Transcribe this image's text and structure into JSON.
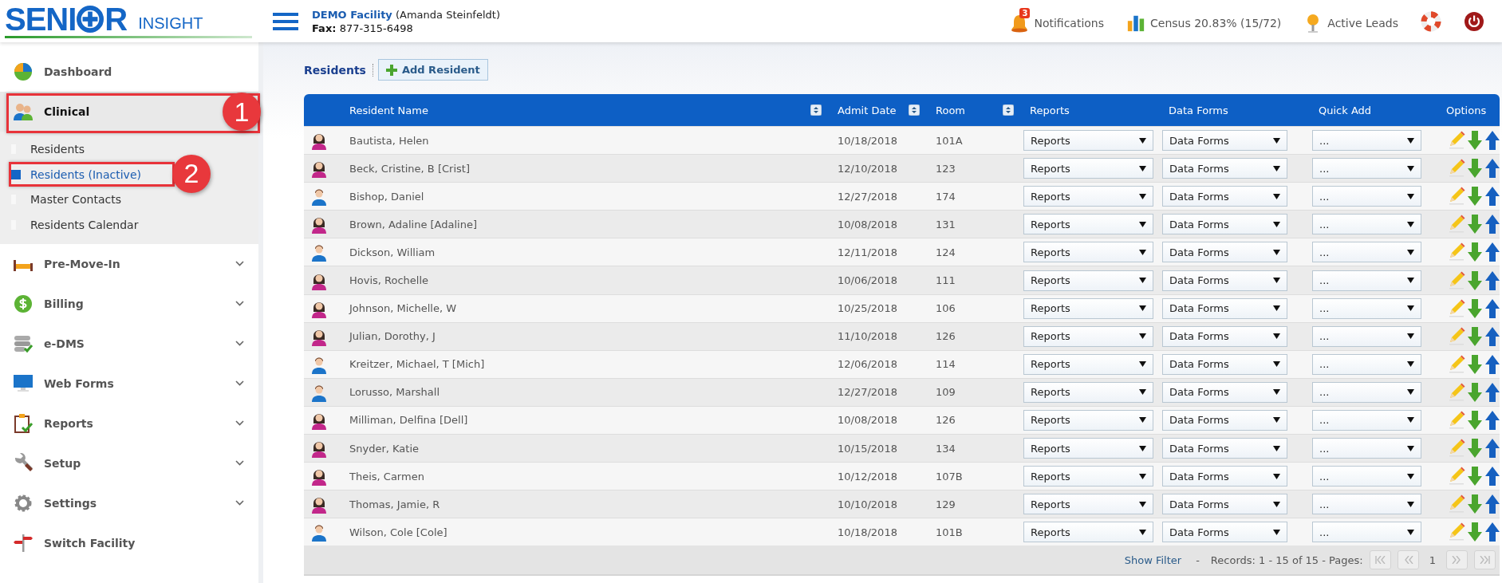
{
  "logo": {
    "left": "SENI",
    "right": "R",
    "tagline": "INSIGHT"
  },
  "facility": {
    "name": "DEMO Facility",
    "user": "(Amanda Steinfeldt)",
    "fax_label": "Fax:",
    "fax": "877-315-6498"
  },
  "top_links": [
    {
      "label": "Notifications",
      "badge": "3"
    },
    {
      "label": "Census 20.83% (15/72)"
    },
    {
      "label": "Active Leads"
    }
  ],
  "sidebar": {
    "items": [
      {
        "label": "Dashboard",
        "kind": "link"
      },
      {
        "label": "Clinical",
        "kind": "group",
        "expanded": true,
        "callout": "1",
        "children": [
          {
            "label": "Residents",
            "selected": false
          },
          {
            "label": "Residents (Inactive)",
            "selected": true,
            "callout": "2"
          },
          {
            "label": "Master Contacts",
            "selected": false
          },
          {
            "label": "Residents Calendar",
            "selected": false
          }
        ]
      },
      {
        "label": "Pre-Move-In",
        "kind": "group",
        "expanded": false
      },
      {
        "label": "Billing",
        "kind": "group",
        "expanded": false
      },
      {
        "label": "e-DMS",
        "kind": "group",
        "expanded": false
      },
      {
        "label": "Web Forms",
        "kind": "group",
        "expanded": false
      },
      {
        "label": "Reports",
        "kind": "group",
        "expanded": false
      },
      {
        "label": "Setup",
        "kind": "group",
        "expanded": false
      },
      {
        "label": "Settings",
        "kind": "group",
        "expanded": false
      },
      {
        "label": "Switch Facility",
        "kind": "link"
      }
    ]
  },
  "page": {
    "title": "Residents",
    "add_button": "Add Resident"
  },
  "table": {
    "columns": [
      {
        "label": "Resident Name"
      },
      {
        "label": "Admit Date"
      },
      {
        "label": "Room"
      },
      {
        "label": "Reports"
      },
      {
        "label": "Data Forms"
      },
      {
        "label": "Quick Add"
      },
      {
        "label": "Options"
      }
    ],
    "rows": [
      {
        "kind": "female",
        "name": "Bautista, Helen",
        "admit": "10/18/2018",
        "room": "101A",
        "reports": "Reports",
        "data_forms": "Data Forms",
        "quick_add": "..."
      },
      {
        "kind": "female",
        "name": "Beck, Cristine, B [Crist]",
        "admit": "12/10/2018",
        "room": "123",
        "reports": "Reports",
        "data_forms": "Data Forms",
        "quick_add": "..."
      },
      {
        "kind": "male",
        "name": "Bishop, Daniel",
        "admit": "12/27/2018",
        "room": "174",
        "reports": "Reports",
        "data_forms": "Data Forms",
        "quick_add": "..."
      },
      {
        "kind": "female",
        "name": "Brown, Adaline [Adaline]",
        "admit": "10/08/2018",
        "room": "131",
        "reports": "Reports",
        "data_forms": "Data Forms",
        "quick_add": "..."
      },
      {
        "kind": "male",
        "name": "Dickson, William",
        "admit": "12/11/2018",
        "room": "124",
        "reports": "Reports",
        "data_forms": "Data Forms",
        "quick_add": "..."
      },
      {
        "kind": "female",
        "name": "Hovis, Rochelle",
        "admit": "10/06/2018",
        "room": "111",
        "reports": "Reports",
        "data_forms": "Data Forms",
        "quick_add": "..."
      },
      {
        "kind": "female",
        "name": "Johnson, Michelle, W",
        "admit": "10/25/2018",
        "room": "106",
        "reports": "Reports",
        "data_forms": "Data Forms",
        "quick_add": "..."
      },
      {
        "kind": "female",
        "name": "Julian, Dorothy, J",
        "admit": "11/10/2018",
        "room": "126",
        "reports": "Reports",
        "data_forms": "Data Forms",
        "quick_add": "..."
      },
      {
        "kind": "male",
        "name": "Kreitzer, Michael, T [Mich]",
        "admit": "12/06/2018",
        "room": "114",
        "reports": "Reports",
        "data_forms": "Data Forms",
        "quick_add": "..."
      },
      {
        "kind": "male",
        "name": "Lorusso, Marshall",
        "admit": "12/27/2018",
        "room": "109",
        "reports": "Reports",
        "data_forms": "Data Forms",
        "quick_add": "..."
      },
      {
        "kind": "female",
        "name": "Milliman, Delfina [Dell]",
        "admit": "10/08/2018",
        "room": "126",
        "reports": "Reports",
        "data_forms": "Data Forms",
        "quick_add": "..."
      },
      {
        "kind": "female",
        "name": "Snyder, Katie",
        "admit": "10/15/2018",
        "room": "134",
        "reports": "Reports",
        "data_forms": "Data Forms",
        "quick_add": "..."
      },
      {
        "kind": "female",
        "name": "Theis, Carmen",
        "admit": "10/12/2018",
        "room": "107B",
        "reports": "Reports",
        "data_forms": "Data Forms",
        "quick_add": "..."
      },
      {
        "kind": "female",
        "name": "Thomas, Jamie, R",
        "admit": "10/10/2018",
        "room": "129",
        "reports": "Reports",
        "data_forms": "Data Forms",
        "quick_add": "..."
      },
      {
        "kind": "male",
        "name": "Wilson, Cole [Cole]",
        "admit": "10/18/2018",
        "room": "101B",
        "reports": "Reports",
        "data_forms": "Data Forms",
        "quick_add": "..."
      }
    ]
  },
  "footer": {
    "filter_link": "Show Filter",
    "separator": "-",
    "records": "Records: 1 - 15 of 15 - Pages:",
    "page": "1"
  }
}
